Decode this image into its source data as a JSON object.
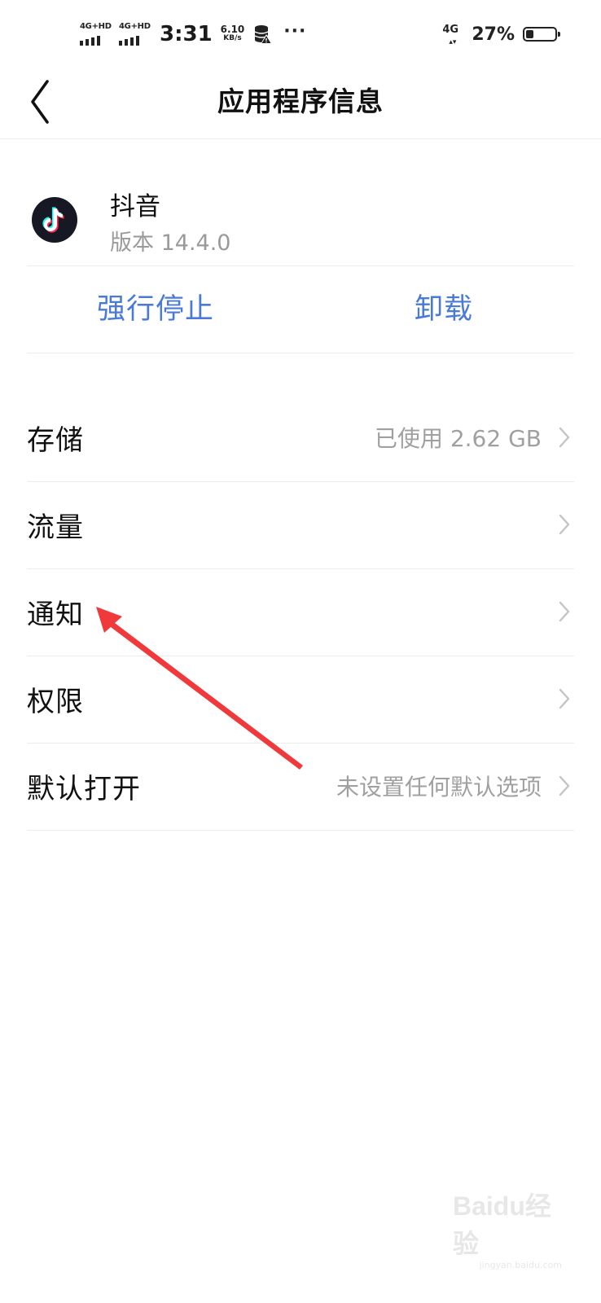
{
  "status_bar": {
    "sim1_label": "4G+HD",
    "sim2_label": "4G+HD",
    "time": "3:31",
    "speed_value": "6.10",
    "speed_unit": "KB/s",
    "more_dots": "···",
    "network_label": "4G",
    "battery_percent": "27%",
    "battery_level": 0.27
  },
  "header": {
    "title": "应用程序信息"
  },
  "app": {
    "name": "抖音",
    "version": "版本 14.4.0",
    "icon": "tiktok-logo"
  },
  "actions": {
    "force_stop": "强行停止",
    "uninstall": "卸载"
  },
  "settings": [
    {
      "id": "storage",
      "label": "存储",
      "value": "已使用 2.62 GB"
    },
    {
      "id": "data-usage",
      "label": "流量",
      "value": ""
    },
    {
      "id": "notifications",
      "label": "通知",
      "value": ""
    },
    {
      "id": "permissions",
      "label": "权限",
      "value": ""
    },
    {
      "id": "open-by-default",
      "label": "默认打开",
      "value": "未设置任何默认选项"
    }
  ],
  "colors": {
    "accent": "#4a7ad8",
    "annotation_arrow": "#f0393a",
    "secondary_text": "#a0a0a0"
  },
  "watermark": {
    "brand": "Baidu经验",
    "url": "jingyan.baidu.com"
  }
}
